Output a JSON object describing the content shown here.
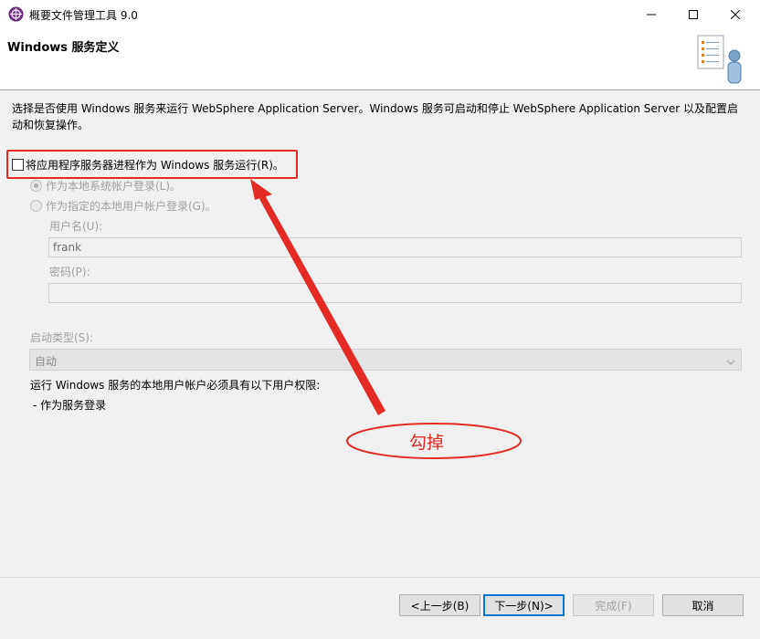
{
  "window": {
    "title": "概要文件管理工具 9.0",
    "controls": {
      "minimize": "minimize",
      "maximize": "maximize",
      "close": "close"
    }
  },
  "header": {
    "title": "Windows 服务定义"
  },
  "description": "选择是否使用 Windows 服务来运行 WebSphere Application Server。Windows 服务可启动和停止 WebSphere Application Server 以及配置启动和恢复操作。",
  "run_as_service": {
    "label": "将应用程序服务器进程作为 Windows 服务运行(R)。",
    "checked": false
  },
  "logon_options": [
    {
      "label": "作为本地系统帐户登录(L)。",
      "selected": true
    },
    {
      "label": "作为指定的本地用户帐户登录(G)。",
      "selected": false
    }
  ],
  "username": {
    "label": "用户名(U):",
    "value": "frank"
  },
  "password": {
    "label": "密码(P):",
    "value": ""
  },
  "startup_type": {
    "label": "启动类型(S):",
    "value": "自动"
  },
  "rights_note": {
    "line1": "运行 Windows 服务的本地用户帐户必须具有以下用户权限:",
    "line2": "-  作为服务登录"
  },
  "annotation": {
    "text": "勾掉",
    "color": "#e32a25"
  },
  "buttons": {
    "back": "<上一步(B)",
    "next": "下一步(N)>",
    "finish": "完成(F)",
    "cancel": "取消"
  }
}
